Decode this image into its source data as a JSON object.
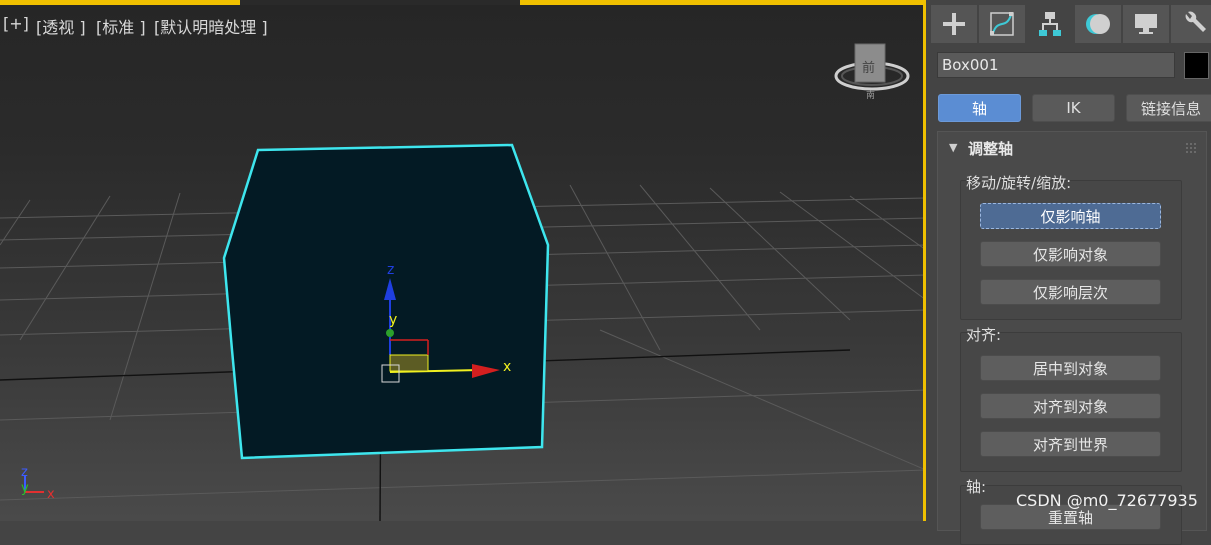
{
  "viewport": {
    "labels": [
      "[+]",
      "[透视 ]",
      "[标准 ]",
      "[默认明暗处理 ]"
    ],
    "viewcube_face": "前",
    "viewcube_bottom": "南",
    "gizmo_axes": {
      "x": "x",
      "y": "y",
      "z": "z"
    },
    "corner_axes": {
      "x": "x",
      "y": "y",
      "z": "z"
    },
    "colors": {
      "selection": "#3ee6ee",
      "box_fill": "#031a24",
      "gizmo_x": "#d41f1f",
      "gizmo_y": "#f0f020",
      "gizmo_z": "#1f3fe0"
    }
  },
  "command_panel": {
    "tabs": [
      {
        "name": "create",
        "icon": "plus-icon"
      },
      {
        "name": "modify",
        "icon": "modify-curve-icon"
      },
      {
        "name": "hierarchy",
        "icon": "hierarchy-icon"
      },
      {
        "name": "motion",
        "icon": "motion-icon"
      },
      {
        "name": "display",
        "icon": "display-monitor-icon"
      },
      {
        "name": "utilities",
        "icon": "wrench-icon"
      }
    ],
    "object_name": "Box001",
    "object_color": "#000000",
    "subtabs": [
      "轴",
      "IK",
      "链接信息"
    ],
    "rollout": {
      "title": "调整轴",
      "group_move": {
        "label": "移动/旋转/缩放:",
        "buttons": [
          "仅影响轴",
          "仅影响对象",
          "仅影响层次"
        ]
      },
      "group_align": {
        "label": "对齐:",
        "buttons": [
          "居中到对象",
          "对齐到对象",
          "对齐到世界"
        ]
      },
      "group_pivot": {
        "label": "轴:",
        "buttons": [
          "重置轴"
        ]
      }
    },
    "accent": "#5b8dd3"
  },
  "watermark": "CSDN @m0_72677935"
}
